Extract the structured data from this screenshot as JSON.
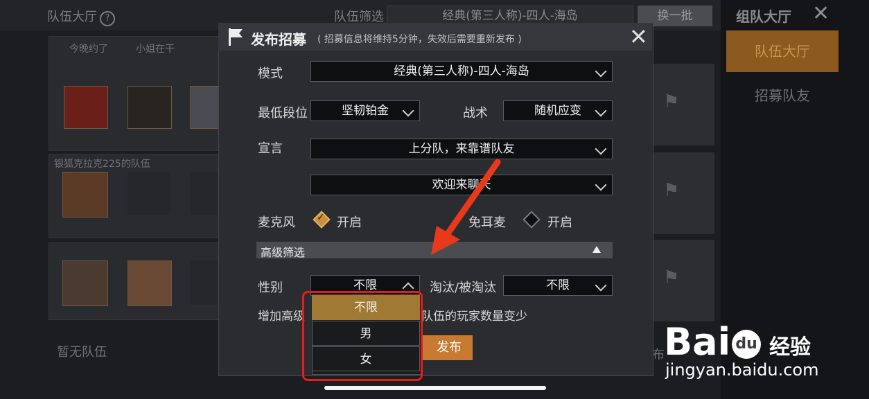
{
  "background": {
    "header_title": "队伍大厅",
    "help_symbol": "?",
    "filter_label": "队伍筛选",
    "filter_value": "经典(第三人称)-四人-海岛",
    "refresh_button": "换一批",
    "team1_tags": [
      "今晚约了",
      "小姐在干"
    ],
    "team2_name": "银狐克拉克225的队伍",
    "empty_text": "暂无队伍",
    "bg_publish_fragment": "布"
  },
  "right_panel": {
    "title": "组队大厅",
    "close": "✕",
    "tab_lobby": "队伍大厅",
    "tab_recruit": "招募队友"
  },
  "modal": {
    "title": "发布招募",
    "subtitle": "( 招募信息将维持5分钟，失效后需要重新发布 )",
    "close": "✕",
    "mode_label": "模式",
    "mode_value": "经典(第三人称)-四人-海岛",
    "min_rank_label": "最低段位",
    "min_rank_value": "坚韧铂金",
    "tactic_label": "战术",
    "tactic_value": "随机应变",
    "declaration_label": "宣言",
    "declaration_1": "上分队，来靠谱队友",
    "declaration_2": "欢迎来聊天",
    "mic_label": "麦克风",
    "mic_value": "开启",
    "mic_checked": true,
    "earphone_label": "免耳麦",
    "earphone_value": "开启",
    "earphone_checked": false,
    "advanced_label": "高级筛选",
    "gender_label": "性别",
    "gender_value": "不限",
    "elim_label": "淘汰/被淘汰",
    "elim_value": "不限",
    "note_left": "增加高级",
    "note_right": "队伍的玩家数量变少",
    "publish_fragment": "发布"
  },
  "dropdown": {
    "options": [
      "不限",
      "男",
      "女"
    ],
    "selected_index": 0
  },
  "watermark": {
    "brand_left": "Bai",
    "brand_du": "du",
    "brand_cn": "经验",
    "url": "jingyan.baidu.com"
  },
  "colors": {
    "accent_orange": "#c97a32",
    "dropdown_selected": "#a07a32",
    "highlight_red": "#e11d1d",
    "arrow_red": "#e8391c"
  }
}
